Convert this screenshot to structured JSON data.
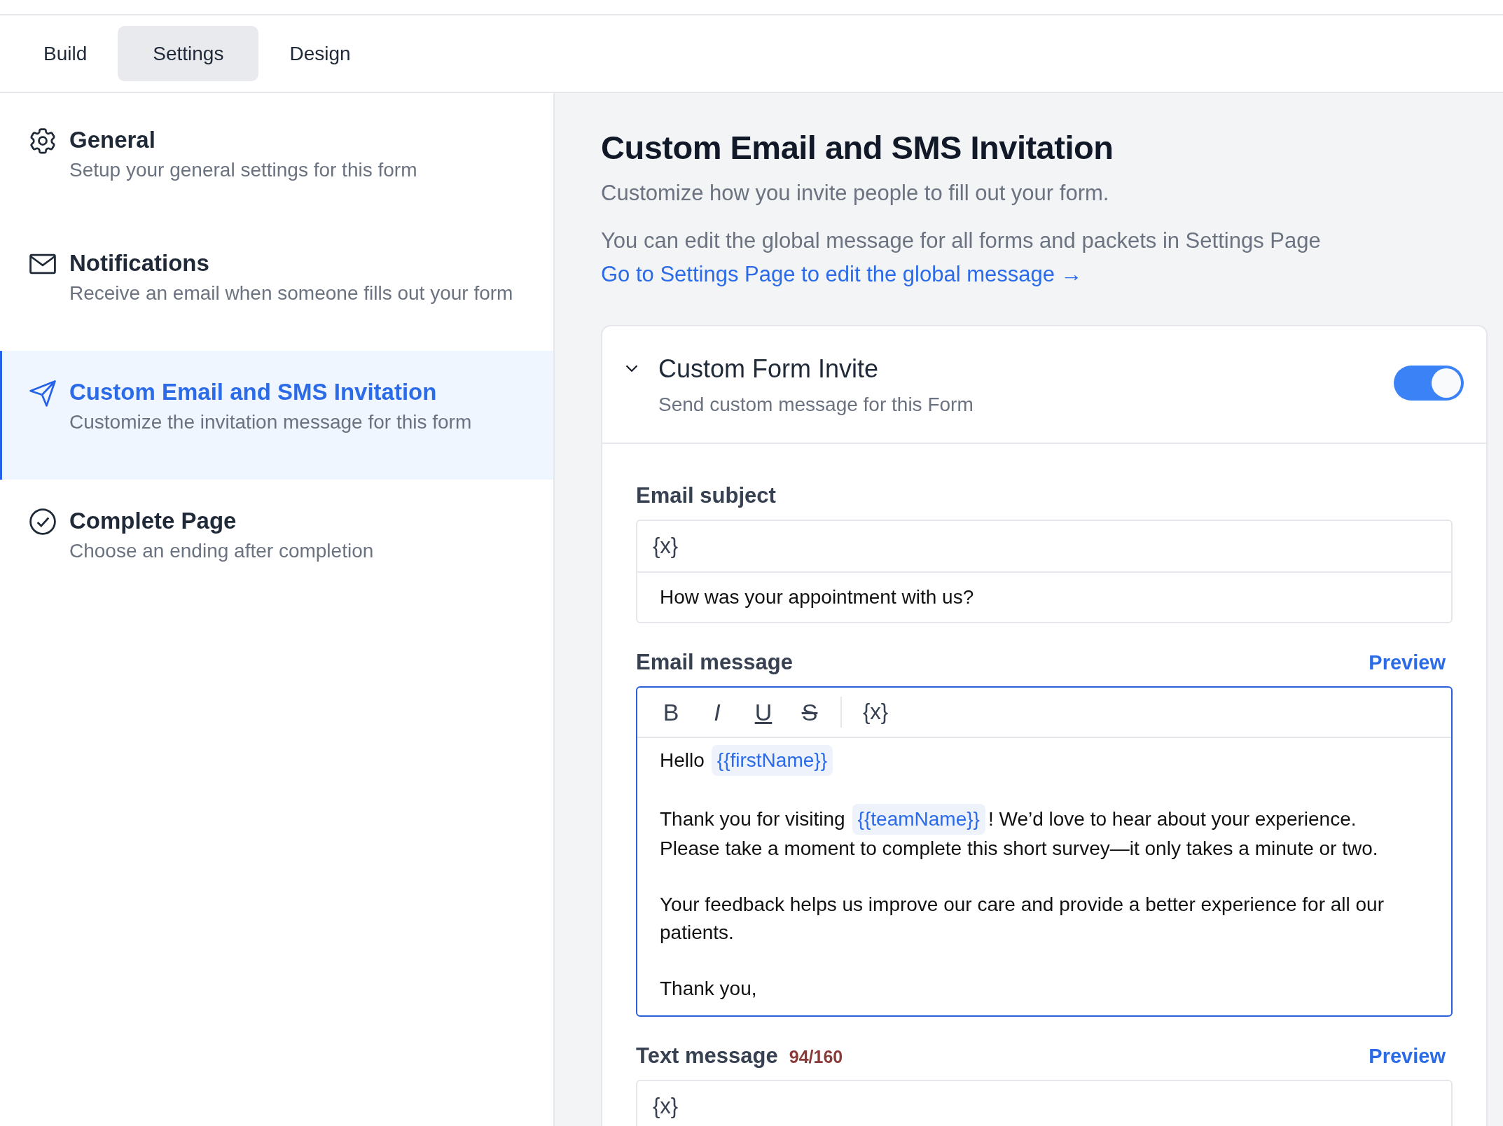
{
  "tabs": [
    {
      "label": "Build",
      "selected": false
    },
    {
      "label": "Settings",
      "selected": true
    },
    {
      "label": "Design",
      "selected": false
    }
  ],
  "sidebar": {
    "items": [
      {
        "kind": "settings",
        "title": "General",
        "description": "Setup your general settings for this form",
        "selected": false
      },
      {
        "kind": "notifications",
        "title": "Notifications",
        "description": "Receive an email when someone fills out your form",
        "selected": false
      },
      {
        "kind": "invitation",
        "title": "Custom Email and SMS Invitation",
        "description": "Customize the invitation message for this form",
        "selected": true
      },
      {
        "kind": "completion",
        "title": "Complete Page",
        "description": "Choose an ending after completion",
        "selected": false
      }
    ]
  },
  "main": {
    "title": "Custom Email and SMS Invitation",
    "subtitle": "Customize how you invite people to fill out your form.",
    "note": "You can edit the global message for all forms and packets in Settings Page",
    "link": "Go to Settings Page to edit the global message →",
    "card": {
      "title": "Custom Form Invite",
      "subtitle": "Send custom message for this Form",
      "expanded": true,
      "on": true,
      "email_subject": {
        "label": "Email subject",
        "variable_button": "{x}",
        "value": "How was your appointment with us?"
      },
      "email_message": {
        "label": "Email message",
        "preview": "Preview",
        "toolbar": [
          {
            "kind": "bold",
            "label": "B"
          },
          {
            "kind": "italic",
            "label": "I"
          },
          {
            "kind": "underline",
            "label": "U"
          },
          {
            "kind": "strike",
            "label": "S"
          },
          {
            "kind": "variable",
            "label": "{x}"
          }
        ],
        "paragraphs": [
          [
            [
              {
                "kind": "text",
                "text": "Hello"
              },
              {
                "kind": "variable",
                "text": "{{firstName}}"
              }
            ]
          ],
          [
            [
              {
                "kind": "text",
                "text": "Thank you for visiting"
              },
              {
                "kind": "variable",
                "text": "{{teamName}}"
              },
              {
                "kind": "text",
                "text": "! We’d love to hear about your experience."
              }
            ],
            [
              {
                "kind": "text",
                "text": "Please take a moment to complete this short survey—it only takes a minute or two."
              }
            ]
          ],
          [
            [
              {
                "kind": "text",
                "text": "Your feedback helps us improve our care and provide a better experience for all our patients."
              }
            ]
          ],
          [
            [
              {
                "kind": "text",
                "text": "Thank you,"
              }
            ]
          ]
        ]
      },
      "text_message": {
        "label": "Text message",
        "counter": "94/160",
        "preview": "Preview",
        "variable_button": "{x}"
      }
    }
  }
}
